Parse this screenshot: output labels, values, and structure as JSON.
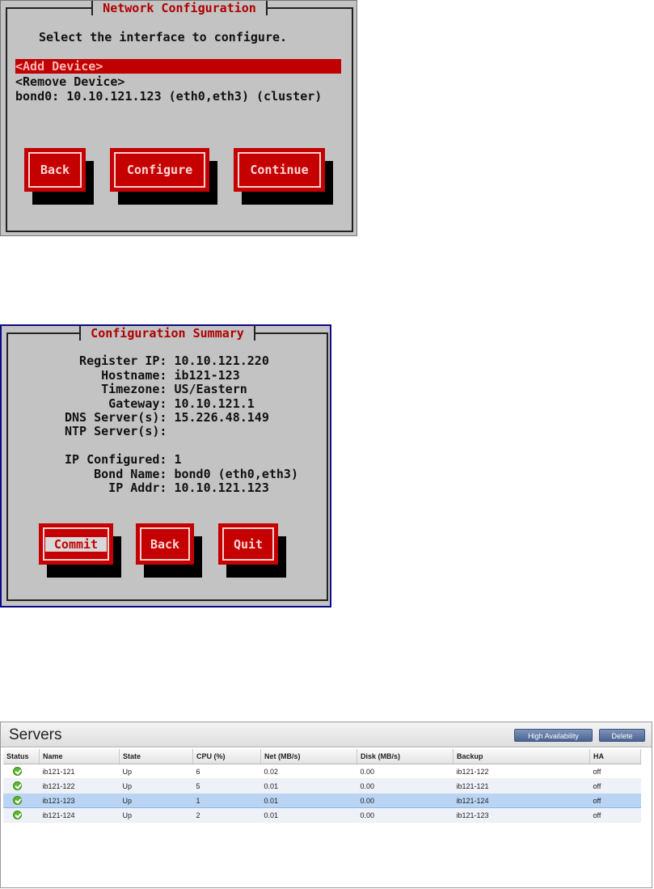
{
  "network_config": {
    "title": "Network Configuration",
    "prompt": "Select the interface to configure.",
    "items": [
      "<Add Device>",
      "<Remove Device>",
      "bond0: 10.10.121.123 (eth0,eth3) (cluster)"
    ],
    "selected_item": "<Add Device>",
    "buttons": {
      "back": "Back",
      "configure": "Configure",
      "continue": "Continue"
    }
  },
  "config_summary": {
    "title": "Configuration Summary",
    "lines": [
      "  Register IP: 10.10.121.220",
      "     Hostname: ib121-123",
      "     Timezone: US/Eastern",
      "      Gateway: 10.10.121.1",
      "DNS Server(s): 15.226.48.149",
      "NTP Server(s):",
      "",
      "IP Configured: 1",
      "    Bond Name: bond0 (eth0,eth3)",
      "      IP Addr: 10.10.121.123"
    ],
    "buttons": {
      "commit": "Commit",
      "back": "Back",
      "quit": "Quit"
    }
  },
  "servers": {
    "title": "Servers",
    "toolbar": {
      "high_availability": "High Availability",
      "delete": "Delete"
    },
    "columns": [
      "Status",
      "Name",
      "State",
      "CPU (%)",
      "Net (MB/s)",
      "Disk (MB/s)",
      "Backup",
      "HA"
    ],
    "rows": [
      {
        "status": "ok",
        "name": "ib121-121",
        "state": "Up",
        "cpu": "6",
        "net": "0.02",
        "disk": "0.00",
        "backup": "ib121-122",
        "ha": "off"
      },
      {
        "status": "ok",
        "name": "ib121-122",
        "state": "Up",
        "cpu": "5",
        "net": "0.01",
        "disk": "0.00",
        "backup": "ib121-121",
        "ha": "off"
      },
      {
        "status": "ok",
        "name": "ib121-123",
        "state": "Up",
        "cpu": "1",
        "net": "0.01",
        "disk": "0.00",
        "backup": "ib121-124",
        "ha": "off"
      },
      {
        "status": "ok",
        "name": "ib121-124",
        "state": "Up",
        "cpu": "2",
        "net": "0.01",
        "disk": "0.00",
        "backup": "ib121-123",
        "ha": "off"
      }
    ],
    "selected_row": "ib121-123"
  },
  "colors": {
    "tui_background": "#c3c3c3",
    "tui_accent": "#c40000",
    "selected_row": "#b9d5f3",
    "status_ok": "#5cb82d"
  }
}
